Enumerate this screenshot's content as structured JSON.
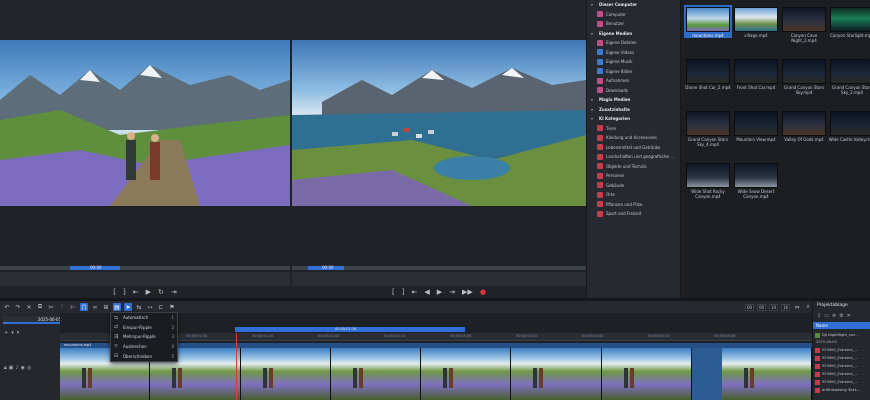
{
  "monitors": {
    "left_timecode": "00:00",
    "right_timecode": "00:00"
  },
  "media_tree": {
    "items": [
      {
        "label": "Dieser Computer",
        "type": "head",
        "icon": "arrow"
      },
      {
        "label": "Computer",
        "type": "sub",
        "icon": "pink"
      },
      {
        "label": "Benutzer",
        "type": "sub",
        "icon": "pink"
      },
      {
        "label": "Eigene Medien",
        "type": "head",
        "icon": "arrow"
      },
      {
        "label": "Eigene Dateien",
        "type": "sub",
        "icon": "pink"
      },
      {
        "label": "Eigene Videos",
        "type": "sub",
        "icon": "blue"
      },
      {
        "label": "Eigene Musik",
        "type": "sub",
        "icon": "blue"
      },
      {
        "label": "Eigene Bilder",
        "type": "sub",
        "icon": "blue"
      },
      {
        "label": "Aufnahmen",
        "type": "sub",
        "icon": "pink"
      },
      {
        "label": "Downloads",
        "type": "sub",
        "icon": "pink"
      },
      {
        "label": "Magix Medien",
        "type": "head",
        "icon": "arrow"
      },
      {
        "label": "Zusatzinhalte",
        "type": "head",
        "icon": "arrow"
      },
      {
        "label": "KI Kategorien",
        "type": "head",
        "icon": "arrow"
      },
      {
        "label": "Tiere",
        "type": "sub",
        "icon": "red"
      },
      {
        "label": "Kleidung und Accessoires",
        "type": "sub",
        "icon": "red"
      },
      {
        "label": "Lebensmittel und Getränke",
        "type": "sub",
        "icon": "red"
      },
      {
        "label": "Landschaften und geografische ...",
        "type": "sub",
        "icon": "red"
      },
      {
        "label": "Objekte und Technik",
        "type": "sub",
        "icon": "red"
      },
      {
        "label": "Personen",
        "type": "sub",
        "icon": "red"
      },
      {
        "label": "Gebäude",
        "type": "sub",
        "icon": "red"
      },
      {
        "label": "Orte",
        "type": "sub",
        "icon": "red"
      },
      {
        "label": "Pflanzen und Pilze",
        "type": "sub",
        "icon": "red"
      },
      {
        "label": "Sport und Freizeit",
        "type": "sub",
        "icon": "red"
      }
    ]
  },
  "media_grid": {
    "items": [
      {
        "name": "mountains.mp4",
        "style": "mountain-img",
        "selected": true
      },
      {
        "name": "village.mp4",
        "style": "village-img",
        "selected": false
      },
      {
        "name": "Canyon Cave Night_2.mp4",
        "style": "canyon",
        "selected": false
      },
      {
        "name": "Canyon Starlight.mp4",
        "style": "aurora",
        "selected": false
      },
      {
        "name": "Drone Shot Car_2.mp4",
        "style": "night",
        "selected": false
      },
      {
        "name": "Front Shot Car.mp4",
        "style": "night",
        "selected": false
      },
      {
        "name": "Grand Canyon Stars Sky.mp4",
        "style": "night",
        "selected": false
      },
      {
        "name": "Grand Canyon Stars Sky_2.mp4",
        "style": "night",
        "selected": false
      },
      {
        "name": "Grand Canyon Stars Sky_4.mp4",
        "style": "canyon",
        "selected": false
      },
      {
        "name": "Mountain View.mp4",
        "style": "night",
        "selected": false
      },
      {
        "name": "Valley Of Gods.mp4",
        "style": "canyon",
        "selected": false
      },
      {
        "name": "Wide Castle Valley.mp4",
        "style": "night",
        "selected": false
      },
      {
        "name": "Wide Shot Rocky Canyon.mp4",
        "style": "snow-img",
        "selected": false
      },
      {
        "name": "Wide Snow Desert Canyon.mp4",
        "style": "snow-img",
        "selected": false
      }
    ]
  },
  "timeline": {
    "tab_label": "2025-06-05*",
    "range_label": "00:00:01:16",
    "track_title": "mountains.mp4",
    "ruler_labels": [
      "00:00:00:10",
      "00:00:01:00",
      "00:00:01:10",
      "00:00:02:00",
      "00:00:02:10",
      "00:00:03:00",
      "00:00:03:10",
      "00:00:04:00",
      "00:00:04:10",
      "00:00:05:00"
    ],
    "timecode_fields": [
      "00",
      "00",
      "10",
      "16"
    ]
  },
  "mode_menu": {
    "items": [
      {
        "label": "Automatisch",
        "key": "1",
        "icon": "auto-mode-icon"
      },
      {
        "label": "Einspur-Ripple",
        "key": "2",
        "icon": "single-ripple-icon"
      },
      {
        "label": "Mehrspur-Ripple",
        "key": "3",
        "icon": "multi-ripple-icon"
      },
      {
        "label": "Ausbrechen",
        "key": "4",
        "icon": "breakout-icon"
      },
      {
        "label": "Überschreiben",
        "key": "5",
        "icon": "overwrite-icon"
      }
    ]
  },
  "project_panel": {
    "title": "Projektablage",
    "column_header": "Name",
    "items": [
      {
        "label": "DJI Nightflight_con...",
        "color": "green"
      },
      {
        "label": "2025-06-05",
        "color": "date"
      },
      {
        "label": "553000_Extreme_...",
        "color": "red"
      },
      {
        "label": "553000_Extreme_...",
        "color": "red"
      },
      {
        "label": "553000_Extreme_...",
        "color": "red"
      },
      {
        "label": "553000_Extreme_...",
        "color": "red"
      },
      {
        "label": "553000_Extreme_...",
        "color": "red"
      },
      {
        "label": "drifthleadsing 3k4k...",
        "color": "red"
      }
    ]
  }
}
